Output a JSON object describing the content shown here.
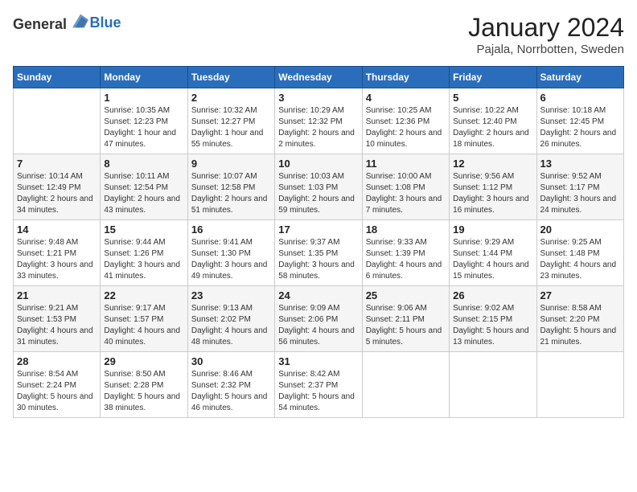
{
  "header": {
    "logo": {
      "general": "General",
      "blue": "Blue"
    },
    "month": "January 2024",
    "location": "Pajala, Norrbotten, Sweden"
  },
  "weekdays": [
    "Sunday",
    "Monday",
    "Tuesday",
    "Wednesday",
    "Thursday",
    "Friday",
    "Saturday"
  ],
  "weeks": [
    [
      {
        "day": "",
        "sunrise": "",
        "sunset": "",
        "daylight": ""
      },
      {
        "day": "1",
        "sunrise": "Sunrise: 10:35 AM",
        "sunset": "Sunset: 12:23 PM",
        "daylight": "Daylight: 1 hour and 47 minutes."
      },
      {
        "day": "2",
        "sunrise": "Sunrise: 10:32 AM",
        "sunset": "Sunset: 12:27 PM",
        "daylight": "Daylight: 1 hour and 55 minutes."
      },
      {
        "day": "3",
        "sunrise": "Sunrise: 10:29 AM",
        "sunset": "Sunset: 12:32 PM",
        "daylight": "Daylight: 2 hours and 2 minutes."
      },
      {
        "day": "4",
        "sunrise": "Sunrise: 10:25 AM",
        "sunset": "Sunset: 12:36 PM",
        "daylight": "Daylight: 2 hours and 10 minutes."
      },
      {
        "day": "5",
        "sunrise": "Sunrise: 10:22 AM",
        "sunset": "Sunset: 12:40 PM",
        "daylight": "Daylight: 2 hours and 18 minutes."
      },
      {
        "day": "6",
        "sunrise": "Sunrise: 10:18 AM",
        "sunset": "Sunset: 12:45 PM",
        "daylight": "Daylight: 2 hours and 26 minutes."
      }
    ],
    [
      {
        "day": "7",
        "sunrise": "Sunrise: 10:14 AM",
        "sunset": "Sunset: 12:49 PM",
        "daylight": "Daylight: 2 hours and 34 minutes."
      },
      {
        "day": "8",
        "sunrise": "Sunrise: 10:11 AM",
        "sunset": "Sunset: 12:54 PM",
        "daylight": "Daylight: 2 hours and 43 minutes."
      },
      {
        "day": "9",
        "sunrise": "Sunrise: 10:07 AM",
        "sunset": "Sunset: 12:58 PM",
        "daylight": "Daylight: 2 hours and 51 minutes."
      },
      {
        "day": "10",
        "sunrise": "Sunrise: 10:03 AM",
        "sunset": "Sunset: 1:03 PM",
        "daylight": "Daylight: 2 hours and 59 minutes."
      },
      {
        "day": "11",
        "sunrise": "Sunrise: 10:00 AM",
        "sunset": "Sunset: 1:08 PM",
        "daylight": "Daylight: 3 hours and 7 minutes."
      },
      {
        "day": "12",
        "sunrise": "Sunrise: 9:56 AM",
        "sunset": "Sunset: 1:12 PM",
        "daylight": "Daylight: 3 hours and 16 minutes."
      },
      {
        "day": "13",
        "sunrise": "Sunrise: 9:52 AM",
        "sunset": "Sunset: 1:17 PM",
        "daylight": "Daylight: 3 hours and 24 minutes."
      }
    ],
    [
      {
        "day": "14",
        "sunrise": "Sunrise: 9:48 AM",
        "sunset": "Sunset: 1:21 PM",
        "daylight": "Daylight: 3 hours and 33 minutes."
      },
      {
        "day": "15",
        "sunrise": "Sunrise: 9:44 AM",
        "sunset": "Sunset: 1:26 PM",
        "daylight": "Daylight: 3 hours and 41 minutes."
      },
      {
        "day": "16",
        "sunrise": "Sunrise: 9:41 AM",
        "sunset": "Sunset: 1:30 PM",
        "daylight": "Daylight: 3 hours and 49 minutes."
      },
      {
        "day": "17",
        "sunrise": "Sunrise: 9:37 AM",
        "sunset": "Sunset: 1:35 PM",
        "daylight": "Daylight: 3 hours and 58 minutes."
      },
      {
        "day": "18",
        "sunrise": "Sunrise: 9:33 AM",
        "sunset": "Sunset: 1:39 PM",
        "daylight": "Daylight: 4 hours and 6 minutes."
      },
      {
        "day": "19",
        "sunrise": "Sunrise: 9:29 AM",
        "sunset": "Sunset: 1:44 PM",
        "daylight": "Daylight: 4 hours and 15 minutes."
      },
      {
        "day": "20",
        "sunrise": "Sunrise: 9:25 AM",
        "sunset": "Sunset: 1:48 PM",
        "daylight": "Daylight: 4 hours and 23 minutes."
      }
    ],
    [
      {
        "day": "21",
        "sunrise": "Sunrise: 9:21 AM",
        "sunset": "Sunset: 1:53 PM",
        "daylight": "Daylight: 4 hours and 31 minutes."
      },
      {
        "day": "22",
        "sunrise": "Sunrise: 9:17 AM",
        "sunset": "Sunset: 1:57 PM",
        "daylight": "Daylight: 4 hours and 40 minutes."
      },
      {
        "day": "23",
        "sunrise": "Sunrise: 9:13 AM",
        "sunset": "Sunset: 2:02 PM",
        "daylight": "Daylight: 4 hours and 48 minutes."
      },
      {
        "day": "24",
        "sunrise": "Sunrise: 9:09 AM",
        "sunset": "Sunset: 2:06 PM",
        "daylight": "Daylight: 4 hours and 56 minutes."
      },
      {
        "day": "25",
        "sunrise": "Sunrise: 9:06 AM",
        "sunset": "Sunset: 2:11 PM",
        "daylight": "Daylight: 5 hours and 5 minutes."
      },
      {
        "day": "26",
        "sunrise": "Sunrise: 9:02 AM",
        "sunset": "Sunset: 2:15 PM",
        "daylight": "Daylight: 5 hours and 13 minutes."
      },
      {
        "day": "27",
        "sunrise": "Sunrise: 8:58 AM",
        "sunset": "Sunset: 2:20 PM",
        "daylight": "Daylight: 5 hours and 21 minutes."
      }
    ],
    [
      {
        "day": "28",
        "sunrise": "Sunrise: 8:54 AM",
        "sunset": "Sunset: 2:24 PM",
        "daylight": "Daylight: 5 hours and 30 minutes."
      },
      {
        "day": "29",
        "sunrise": "Sunrise: 8:50 AM",
        "sunset": "Sunset: 2:28 PM",
        "daylight": "Daylight: 5 hours and 38 minutes."
      },
      {
        "day": "30",
        "sunrise": "Sunrise: 8:46 AM",
        "sunset": "Sunset: 2:32 PM",
        "daylight": "Daylight: 5 hours and 46 minutes."
      },
      {
        "day": "31",
        "sunrise": "Sunrise: 8:42 AM",
        "sunset": "Sunset: 2:37 PM",
        "daylight": "Daylight: 5 hours and 54 minutes."
      },
      {
        "day": "",
        "sunrise": "",
        "sunset": "",
        "daylight": ""
      },
      {
        "day": "",
        "sunrise": "",
        "sunset": "",
        "daylight": ""
      },
      {
        "day": "",
        "sunrise": "",
        "sunset": "",
        "daylight": ""
      }
    ]
  ]
}
